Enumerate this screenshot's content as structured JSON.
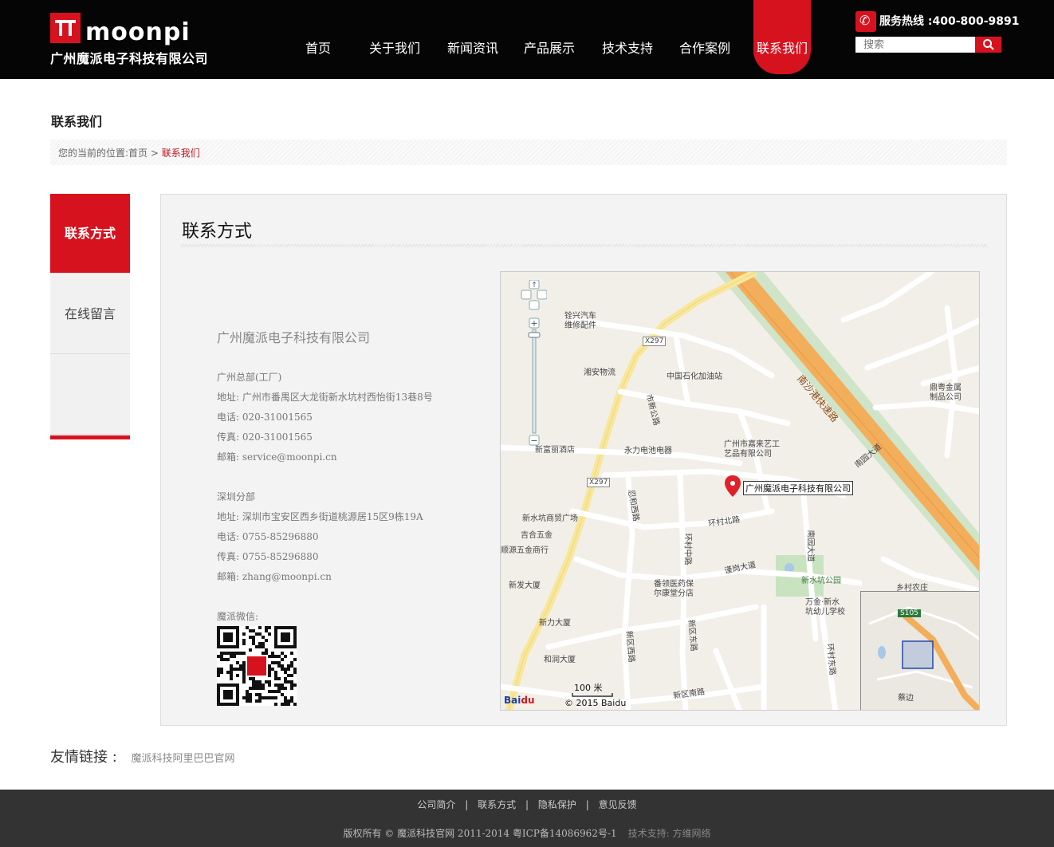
{
  "header": {
    "logo_word": "moonpi",
    "logo_cn": "广州魔派电子科技有限公司",
    "hotline_label": "服务热线 :400-800-9891",
    "search_placeholder": "搜索"
  },
  "nav": [
    {
      "label": "首页"
    },
    {
      "label": "关于我们"
    },
    {
      "label": "新闻资讯"
    },
    {
      "label": "产品展示"
    },
    {
      "label": "技术支持"
    },
    {
      "label": "合作案例"
    },
    {
      "label": "联系我们",
      "active": true
    }
  ],
  "page": {
    "title": "联系我们",
    "breadcrumb_prefix": "您的当前的位置:",
    "breadcrumb_home": "首页",
    "breadcrumb_sep": " > ",
    "breadcrumb_current": "联系我们"
  },
  "side": [
    {
      "label": "联系方式",
      "active": true
    },
    {
      "label": "在线留言"
    },
    {
      "label": ""
    }
  ],
  "panel": {
    "title": "联系方式",
    "company": "广州魔派电子科技有限公司",
    "gz_title": "广州总部(工厂)",
    "gz_addr": "地址: 广州市番禺区大龙街新水坑村西怡街13巷8号",
    "gz_tel": "电话: 020-31001565",
    "gz_fax": "传真: 020-31001565",
    "gz_mail": "邮箱: service@moonpi.cn",
    "sz_title": "深圳分部",
    "sz_addr": "地址: 深圳市宝安区西乡街道桃源居15区9栋19A",
    "sz_tel": "电话: 0755-85296880",
    "sz_fax": "传真: 0755-85296880",
    "sz_mail": "邮箱: zhang@moonpi.cn",
    "wechat": "魔派微信:"
  },
  "map": {
    "labels": {
      "l1": "铨兴汽车",
      "l1b": "维修配件",
      "l2": "X297",
      "l3": "湘安物流",
      "l4": "中国石化加油站",
      "l5": "新富丽酒店",
      "l6": "永力电池电器",
      "l7": "广州市嘉来艺工",
      "l7b": "艺品有限公司",
      "l8": "广州魔派电子科技有限公司",
      "l9": "新水坑商贸广场",
      "l10": "吉合五金",
      "l11": "顺源五金商行",
      "l12": "新发大厦",
      "l13": "新力大厦",
      "l14": "和润大厦",
      "l15": "番领医药保",
      "l15b": "尔康堂分店",
      "l16": "新水坑公园",
      "l17": "乡村农庄",
      "l18": "万金·新水",
      "l18b": "坑幼儿学校",
      "l19": "鼎粤金属",
      "l19b": "制品公司",
      "l20": "南沙港快速路",
      "l21": "南园大道",
      "l22": "环村北路",
      "l23": "谨岗大道",
      "l24": "新区南路",
      "l25": "100 米",
      "l26": "© 2015 Baidu",
      "l27": "S105",
      "l28": "蔡边",
      "l29": "市新公路",
      "l30": "忍和西路",
      "l31": "环村中路",
      "l32": "新区西路",
      "l33": "新区东路",
      "l34": "环村东路",
      "l35": "南园大道",
      "l36": "X297"
    }
  },
  "friends": {
    "label": "友情链接 :",
    "link": "魔派科技阿里巴巴官网"
  },
  "footer": {
    "links": [
      "公司简介",
      "|",
      "联系方式",
      "|",
      "隐私保护",
      "|",
      "意见反馈"
    ],
    "copyright": "版权所有 © 魔派科技官网 2011-2014 粤ICP备14086962号-1",
    "tech": "技术支持: 方维网络"
  },
  "colors": {
    "brand_red": "#d7121f",
    "header_bg": "#050505",
    "footer_bg": "#333333"
  }
}
